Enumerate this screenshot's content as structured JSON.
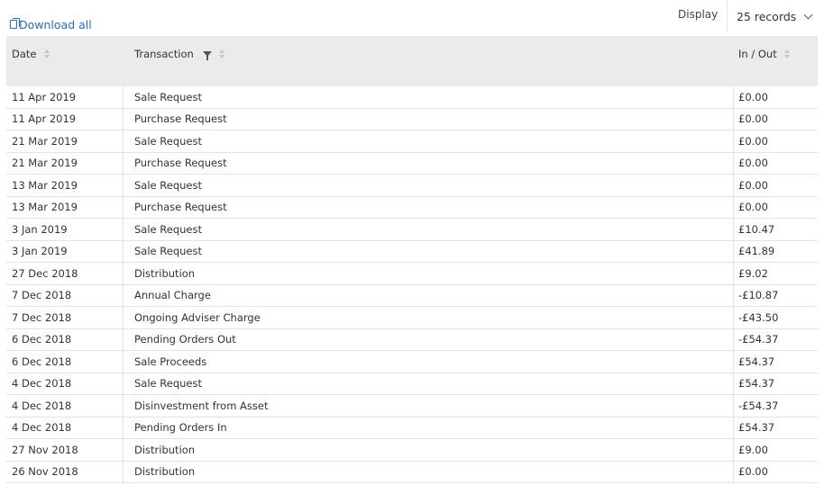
{
  "toolbar": {
    "download_label": "Download all",
    "display_label": "Display",
    "records_value": "25 records"
  },
  "table": {
    "headers": {
      "date": "Date",
      "transaction": "Transaction",
      "in_out": "In / Out"
    },
    "rows": [
      {
        "date": "11 Apr 2019",
        "transaction": "Sale Request",
        "amount": "£0.00"
      },
      {
        "date": "11 Apr 2019",
        "transaction": "Purchase Request",
        "amount": "£0.00"
      },
      {
        "date": "21 Mar 2019",
        "transaction": "Sale Request",
        "amount": "£0.00"
      },
      {
        "date": "21 Mar 2019",
        "transaction": "Purchase Request",
        "amount": "£0.00"
      },
      {
        "date": "13 Mar 2019",
        "transaction": "Sale Request",
        "amount": "£0.00"
      },
      {
        "date": "13 Mar 2019",
        "transaction": "Purchase Request",
        "amount": "£0.00"
      },
      {
        "date": "3 Jan 2019",
        "transaction": "Sale Request",
        "amount": "£10.47"
      },
      {
        "date": "3 Jan 2019",
        "transaction": "Sale Request",
        "amount": "£41.89"
      },
      {
        "date": "27 Dec 2018",
        "transaction": "Distribution",
        "amount": "£9.02"
      },
      {
        "date": "7 Dec 2018",
        "transaction": "Annual Charge",
        "amount": "-£10.87"
      },
      {
        "date": "7 Dec 2018",
        "transaction": "Ongoing Adviser Charge",
        "amount": "-£43.50"
      },
      {
        "date": "6 Dec 2018",
        "transaction": "Pending Orders Out",
        "amount": "-£54.37"
      },
      {
        "date": "6 Dec 2018",
        "transaction": "Sale Proceeds",
        "amount": "£54.37"
      },
      {
        "date": "4 Dec 2018",
        "transaction": "Sale Request",
        "amount": "£54.37"
      },
      {
        "date": "4 Dec 2018",
        "transaction": "Disinvestment from Asset",
        "amount": "-£54.37"
      },
      {
        "date": "4 Dec 2018",
        "transaction": "Pending Orders In",
        "amount": "£54.37"
      },
      {
        "date": "27 Nov 2018",
        "transaction": "Distribution",
        "amount": "£9.00"
      },
      {
        "date": "26 Nov 2018",
        "transaction": "Distribution",
        "amount": "£0.00"
      }
    ]
  },
  "colors": {
    "link": "#2a6fb0",
    "header_bg": "#ebebeb"
  }
}
